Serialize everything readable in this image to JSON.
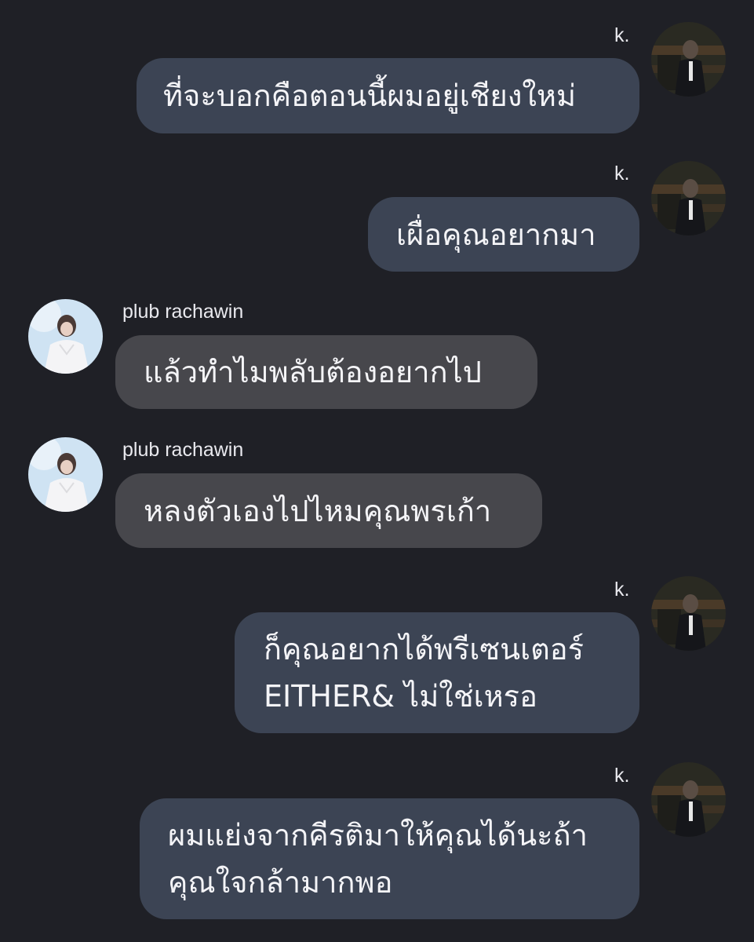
{
  "conversation": {
    "messages": [
      {
        "sender": "k.",
        "direction": "outgoing",
        "text": "ที่จะบอกคือตอนนี้ผมอยู่เชียงใหม่"
      },
      {
        "sender": "k.",
        "direction": "outgoing",
        "text": "เผื่อคุณอยากมา"
      },
      {
        "sender": "plub rachawin",
        "direction": "incoming",
        "text": "แล้วทำไมพลับต้องอยากไป"
      },
      {
        "sender": "plub rachawin",
        "direction": "incoming",
        "text": "หลงตัวเองไปไหมคุณพรเก้า"
      },
      {
        "sender": "k.",
        "direction": "outgoing",
        "text": "ก็คุณอยากได้พรีเซนเตอร์\nEITHER& ไม่ใช่เหรอ"
      },
      {
        "sender": "k.",
        "direction": "outgoing",
        "text": "ผมแย่งจากคีรติมาให้คุณได้นะถ้า\nคุณใจกล้ามากพอ"
      }
    ]
  },
  "colors": {
    "background": "#1f2026",
    "outgoing_bubble": "#3c4454",
    "incoming_bubble": "#47474c",
    "text": "#f4f4f7"
  }
}
